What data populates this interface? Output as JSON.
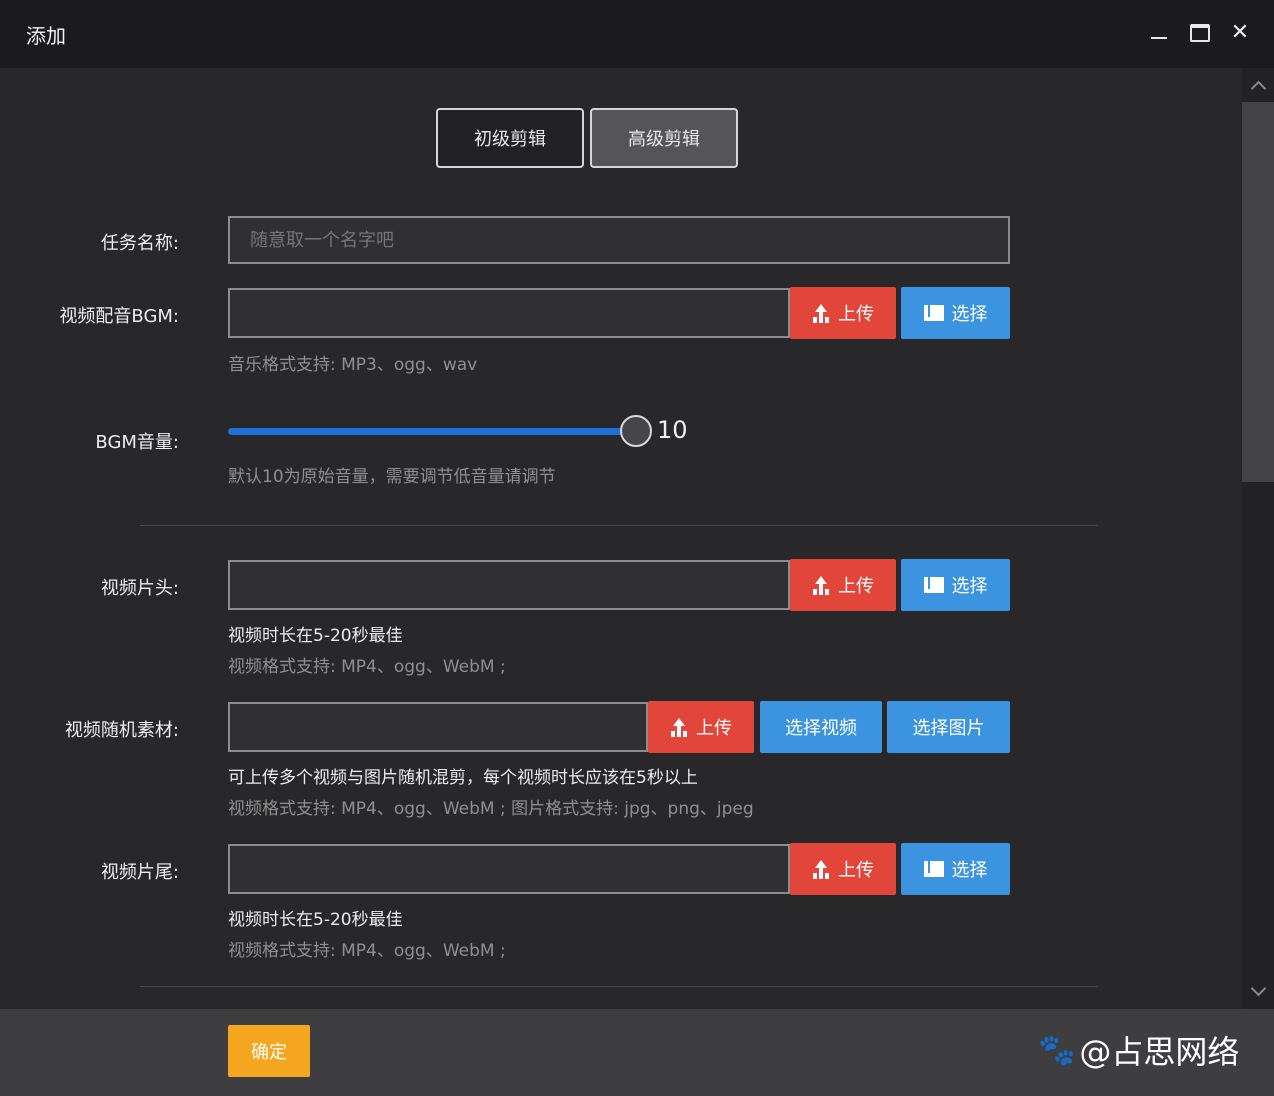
{
  "window": {
    "title": "添加",
    "close_glyph": "✕"
  },
  "tabs": [
    {
      "label": "初级剪辑",
      "active": false
    },
    {
      "label": "高级剪辑",
      "active": true
    }
  ],
  "form": {
    "task_name": {
      "label": "任务名称:",
      "placeholder": "随意取一个名字吧",
      "value": ""
    },
    "bgm": {
      "label": "视频配音BGM:",
      "upload": "上传",
      "select": "选择",
      "hint": "音乐格式支持: MP3、ogg、wav"
    },
    "bgm_volume": {
      "label": "BGM音量:",
      "value": 10,
      "value_text": "10",
      "hint": "默认10为原始音量，需要调节低音量请调节"
    },
    "intro": {
      "label": "视频片头:",
      "upload": "上传",
      "select": "选择",
      "hint_strong": "视频时长在5-20秒最佳",
      "hint": "视频格式支持: MP4、ogg、WebM ;"
    },
    "random_material": {
      "label": "视频随机素材:",
      "upload": "上传",
      "select_video": "选择视频",
      "select_image": "选择图片",
      "hint_strong": "可上传多个视频与图片随机混剪，每个视频时长应该在5秒以上",
      "hint": "视频格式支持: MP4、ogg、WebM ; 图片格式支持: jpg、png、jpeg"
    },
    "outro": {
      "label": "视频片尾:",
      "upload": "上传",
      "select": "选择",
      "hint_strong": "视频时长在5-20秒最佳",
      "hint": "视频格式支持: MP4、ogg、WebM ;"
    }
  },
  "footer": {
    "confirm": "确定",
    "watermark": "@占思网络",
    "watermark_icon": "paw-icon"
  },
  "colors": {
    "upload": "#e2453a",
    "select": "#3c94e0",
    "confirm": "#f5a621",
    "slider": "#1f6fd8"
  }
}
